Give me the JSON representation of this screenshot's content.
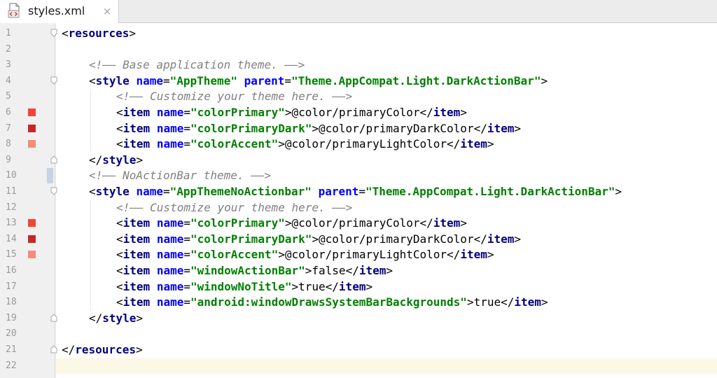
{
  "tab": {
    "title": "styles.xml",
    "close_symbol": "×",
    "icon": "xml-file-icon"
  },
  "colors": {
    "tag": "#000080",
    "attr": "#0000ff",
    "value": "#008000",
    "comment": "#808080",
    "current_line": "#fcf8e6",
    "primary": "#f44336",
    "primary_dark": "#c62828",
    "accent": "#f58c7a"
  },
  "editor": {
    "current_line": 22,
    "lines": [
      {
        "n": "1",
        "indent": 0,
        "fold": "open",
        "tokens": [
          [
            "punct",
            "<"
          ],
          [
            "tag",
            "resources"
          ],
          [
            "punct",
            ">"
          ]
        ]
      },
      {
        "n": "2",
        "indent": 0,
        "tokens": []
      },
      {
        "n": "3",
        "indent": 1,
        "tokens": [
          [
            "comment",
            "<!—— Base application theme. ——>"
          ]
        ]
      },
      {
        "n": "4",
        "indent": 1,
        "fold": "open",
        "tokens": [
          [
            "punct",
            "<"
          ],
          [
            "tag",
            "style"
          ],
          [
            "text",
            " "
          ],
          [
            "attr",
            "name"
          ],
          [
            "punct",
            "="
          ],
          [
            "val",
            "\"AppTheme\""
          ],
          [
            "text",
            " "
          ],
          [
            "attr",
            "parent"
          ],
          [
            "punct",
            "="
          ],
          [
            "val",
            "\"Theme.AppCompat.Light.DarkActionBar\""
          ],
          [
            "punct",
            ">"
          ]
        ]
      },
      {
        "n": "5",
        "indent": 2,
        "tokens": [
          [
            "comment",
            "<!—— Customize your theme here. ——>"
          ]
        ]
      },
      {
        "n": "6",
        "indent": 2,
        "swatch": "primary",
        "tokens": [
          [
            "punct",
            "<"
          ],
          [
            "tag",
            "item"
          ],
          [
            "text",
            " "
          ],
          [
            "attr",
            "name"
          ],
          [
            "punct",
            "="
          ],
          [
            "val",
            "\"colorPrimary\""
          ],
          [
            "punct",
            ">"
          ],
          [
            "text",
            "@color/primaryColor"
          ],
          [
            "punct",
            "</"
          ],
          [
            "tag",
            "item"
          ],
          [
            "punct",
            ">"
          ]
        ]
      },
      {
        "n": "7",
        "indent": 2,
        "swatch": "primary_dark",
        "tokens": [
          [
            "punct",
            "<"
          ],
          [
            "tag",
            "item"
          ],
          [
            "text",
            " "
          ],
          [
            "attr",
            "name"
          ],
          [
            "punct",
            "="
          ],
          [
            "val",
            "\"colorPrimaryDark\""
          ],
          [
            "punct",
            ">"
          ],
          [
            "text",
            "@color/primaryDarkColor"
          ],
          [
            "punct",
            "</"
          ],
          [
            "tag",
            "item"
          ],
          [
            "punct",
            ">"
          ]
        ]
      },
      {
        "n": "8",
        "indent": 2,
        "swatch": "accent",
        "tokens": [
          [
            "punct",
            "<"
          ],
          [
            "tag",
            "item"
          ],
          [
            "text",
            " "
          ],
          [
            "attr",
            "name"
          ],
          [
            "punct",
            "="
          ],
          [
            "val",
            "\"colorAccent\""
          ],
          [
            "punct",
            ">"
          ],
          [
            "text",
            "@color/primaryLightColor"
          ],
          [
            "punct",
            "</"
          ],
          [
            "tag",
            "item"
          ],
          [
            "punct",
            ">"
          ]
        ]
      },
      {
        "n": "9",
        "indent": 1,
        "fold": "close",
        "tokens": [
          [
            "punct",
            "</"
          ],
          [
            "tag",
            "style"
          ],
          [
            "punct",
            ">"
          ]
        ]
      },
      {
        "n": "10",
        "indent": 1,
        "change": true,
        "tokens": [
          [
            "comment",
            "<!—— NoActionBar theme. ——>"
          ]
        ]
      },
      {
        "n": "11",
        "indent": 1,
        "fold": "open",
        "tokens": [
          [
            "punct",
            "<"
          ],
          [
            "tag",
            "style"
          ],
          [
            "text",
            " "
          ],
          [
            "attr",
            "name"
          ],
          [
            "punct",
            "="
          ],
          [
            "val",
            "\"AppThemeNoActionbar\""
          ],
          [
            "text",
            " "
          ],
          [
            "attr",
            "parent"
          ],
          [
            "punct",
            "="
          ],
          [
            "val",
            "\"Theme.AppCompat.Light.DarkActionBar\""
          ],
          [
            "punct",
            ">"
          ]
        ]
      },
      {
        "n": "12",
        "indent": 2,
        "tokens": [
          [
            "comment",
            "<!—— Customize your theme here. ——>"
          ]
        ]
      },
      {
        "n": "13",
        "indent": 2,
        "swatch": "primary",
        "tokens": [
          [
            "punct",
            "<"
          ],
          [
            "tag",
            "item"
          ],
          [
            "text",
            " "
          ],
          [
            "attr",
            "name"
          ],
          [
            "punct",
            "="
          ],
          [
            "val",
            "\"colorPrimary\""
          ],
          [
            "punct",
            ">"
          ],
          [
            "text",
            "@color/primaryColor"
          ],
          [
            "punct",
            "</"
          ],
          [
            "tag",
            "item"
          ],
          [
            "punct",
            ">"
          ]
        ]
      },
      {
        "n": "14",
        "indent": 2,
        "swatch": "primary_dark",
        "tokens": [
          [
            "punct",
            "<"
          ],
          [
            "tag",
            "item"
          ],
          [
            "text",
            " "
          ],
          [
            "attr",
            "name"
          ],
          [
            "punct",
            "="
          ],
          [
            "val",
            "\"colorPrimaryDark\""
          ],
          [
            "punct",
            ">"
          ],
          [
            "text",
            "@color/primaryDarkColor"
          ],
          [
            "punct",
            "</"
          ],
          [
            "tag",
            "item"
          ],
          [
            "punct",
            ">"
          ]
        ]
      },
      {
        "n": "15",
        "indent": 2,
        "swatch": "accent",
        "tokens": [
          [
            "punct",
            "<"
          ],
          [
            "tag",
            "item"
          ],
          [
            "text",
            " "
          ],
          [
            "attr",
            "name"
          ],
          [
            "punct",
            "="
          ],
          [
            "val",
            "\"colorAccent\""
          ],
          [
            "punct",
            ">"
          ],
          [
            "text",
            "@color/primaryLightColor"
          ],
          [
            "punct",
            "</"
          ],
          [
            "tag",
            "item"
          ],
          [
            "punct",
            ">"
          ]
        ]
      },
      {
        "n": "16",
        "indent": 2,
        "tokens": [
          [
            "punct",
            "<"
          ],
          [
            "tag",
            "item"
          ],
          [
            "text",
            " "
          ],
          [
            "attr",
            "name"
          ],
          [
            "punct",
            "="
          ],
          [
            "val",
            "\"windowActionBar\""
          ],
          [
            "punct",
            ">"
          ],
          [
            "text",
            "false"
          ],
          [
            "punct",
            "</"
          ],
          [
            "tag",
            "item"
          ],
          [
            "punct",
            ">"
          ]
        ]
      },
      {
        "n": "17",
        "indent": 2,
        "tokens": [
          [
            "punct",
            "<"
          ],
          [
            "tag",
            "item"
          ],
          [
            "text",
            " "
          ],
          [
            "attr",
            "name"
          ],
          [
            "punct",
            "="
          ],
          [
            "val",
            "\"windowNoTitle\""
          ],
          [
            "punct",
            ">"
          ],
          [
            "text",
            "true"
          ],
          [
            "punct",
            "</"
          ],
          [
            "tag",
            "item"
          ],
          [
            "punct",
            ">"
          ]
        ]
      },
      {
        "n": "18",
        "indent": 2,
        "tokens": [
          [
            "punct",
            "<"
          ],
          [
            "tag",
            "item"
          ],
          [
            "text",
            " "
          ],
          [
            "attr",
            "name"
          ],
          [
            "punct",
            "="
          ],
          [
            "val",
            "\"android:windowDrawsSystemBarBackgrounds\""
          ],
          [
            "punct",
            ">"
          ],
          [
            "text",
            "true"
          ],
          [
            "punct",
            "</"
          ],
          [
            "tag",
            "item"
          ],
          [
            "punct",
            ">"
          ]
        ]
      },
      {
        "n": "19",
        "indent": 1,
        "fold": "close",
        "tokens": [
          [
            "punct",
            "</"
          ],
          [
            "tag",
            "style"
          ],
          [
            "punct",
            ">"
          ]
        ]
      },
      {
        "n": "20",
        "indent": 0,
        "tokens": []
      },
      {
        "n": "21",
        "indent": 0,
        "fold": "close",
        "tokens": [
          [
            "punct",
            "</"
          ],
          [
            "tag",
            "resources"
          ],
          [
            "punct",
            ">"
          ]
        ]
      },
      {
        "n": "22",
        "indent": 0,
        "tokens": []
      }
    ]
  }
}
